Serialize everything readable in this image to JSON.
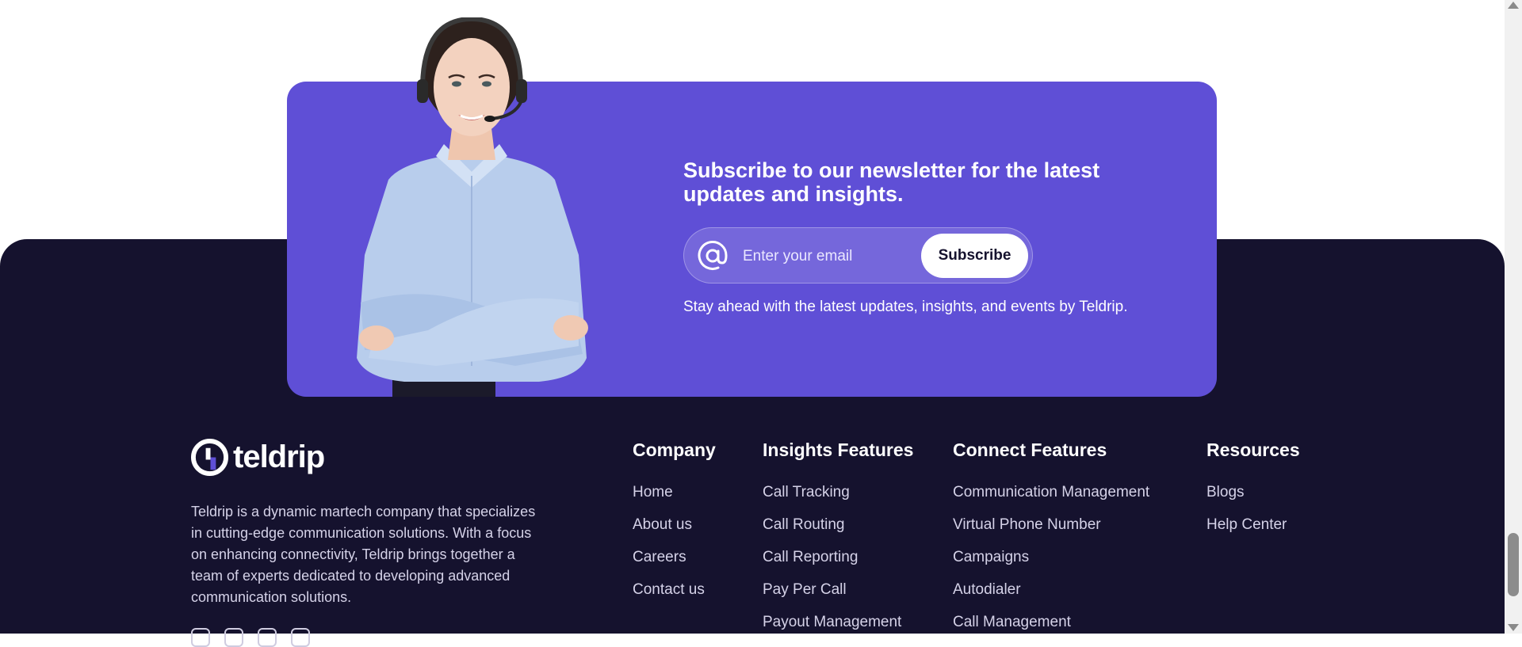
{
  "newsletter": {
    "title": "Subscribe to our newsletter for the latest updates and insights.",
    "email_placeholder": "Enter your email",
    "subscribe_label": "Subscribe",
    "note": "Stay ahead with the latest updates, insights, and events by Teldrip."
  },
  "brand": {
    "name": "teldrip",
    "description": "Teldrip is a dynamic martech company that specializes in cutting-edge communication solutions. With a focus on enhancing connectivity, Teldrip brings together a team of experts dedicated to developing advanced communication solutions.",
    "accent_color": "#5f4fd6",
    "footer_bg": "#15122e"
  },
  "company": {
    "heading": "Company",
    "links": [
      "Home",
      "About us",
      "Careers",
      "Contact us"
    ]
  },
  "insights": {
    "heading": "Insights Features",
    "links": [
      "Call Tracking",
      "Call Routing",
      "Call Reporting",
      "Pay Per Call",
      "Payout Management"
    ]
  },
  "connect": {
    "heading": "Connect Features",
    "links": [
      "Communication Management",
      "Virtual Phone Number",
      "Campaigns",
      "Autodialer",
      "Call Management"
    ]
  },
  "resources": {
    "heading": "Resources",
    "links": [
      "Blogs",
      "Help Center"
    ]
  },
  "icons": [
    "at-icon",
    "teldrip-logo-icon",
    "social-icon",
    "scroll-up-icon",
    "scroll-down-icon"
  ]
}
